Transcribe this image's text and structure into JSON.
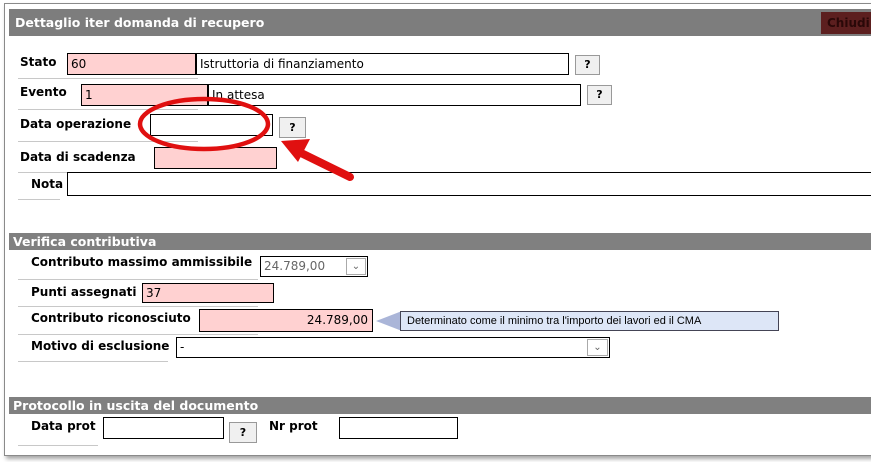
{
  "dialog": {
    "title": "Dettaglio iter domanda di recupero",
    "close_label": "Chiudi"
  },
  "stato": {
    "label": "Stato",
    "code": "60",
    "description": "Istruttoria di finanziamento",
    "help_label": "?"
  },
  "evento": {
    "label": "Evento",
    "code": "1",
    "description": "In attesa",
    "help_label": "?"
  },
  "data_operazione": {
    "label": "Data operazione",
    "value": "",
    "help_label": "?"
  },
  "data_scadenza": {
    "label": "Data di scadenza",
    "value": ""
  },
  "nota": {
    "label": "Nota",
    "value": ""
  },
  "verifica": {
    "section_title": "Verifica contributiva",
    "contributo_massimo": {
      "label": "Contributo massimo ammissibile",
      "value": "24.789,00"
    },
    "punti": {
      "label": "Punti assegnati",
      "value": "37"
    },
    "contributo_riconosciuto": {
      "label": "Contributo riconosciuto",
      "value": "24.789,00",
      "hint": "Determinato come il minimo tra l'importo dei lavori ed il CMA"
    },
    "motivo": {
      "label": "Motivo di esclusione",
      "value": "-"
    }
  },
  "protocollo": {
    "section_title": "Protocollo in uscita del documento",
    "data_prot": {
      "label": "Data prot",
      "value": "",
      "help_label": "?"
    },
    "nr_prot": {
      "label": "Nr prot",
      "value": ""
    }
  },
  "annotation": {
    "color": "#e01010"
  }
}
